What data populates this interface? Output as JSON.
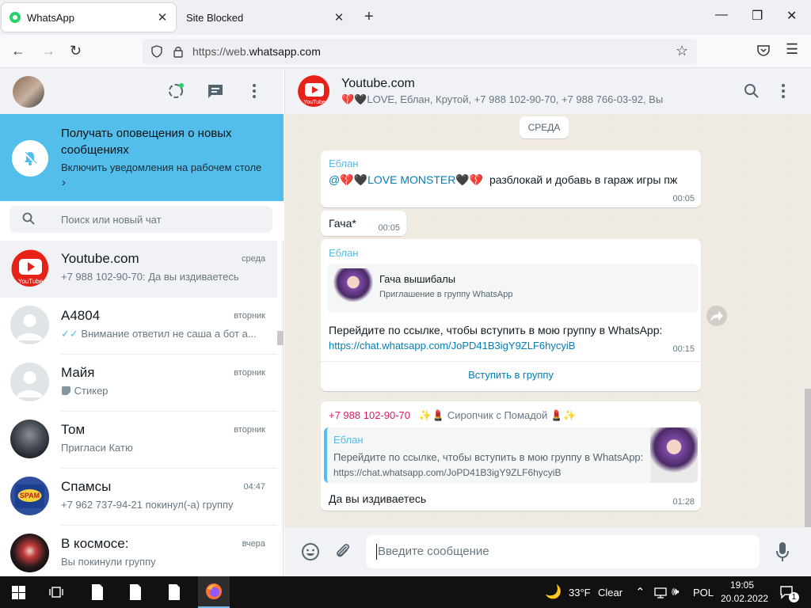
{
  "browser": {
    "tabs": [
      {
        "label": "WhatsApp",
        "active": true
      },
      {
        "label": "Site Blocked",
        "active": false
      }
    ],
    "url": {
      "prefix": "https://web.",
      "domain": "whatsapp.com"
    }
  },
  "sidebar": {
    "notification": {
      "title": "Получать оповещения о новых сообщениях",
      "subtitle": "Включить уведомления на рабочем столе",
      "chevron": "›"
    },
    "search": {
      "placeholder": "Поиск или новый чат"
    },
    "chats": [
      {
        "name": "Youtube.com",
        "time": "среда",
        "last": "+7 988 102-90-70: Да вы издиваетесь",
        "avatar": "youtube"
      },
      {
        "name": "A4804",
        "time": "вторник",
        "last": "Внимание ответил не саша а бот а...",
        "avatar": "default",
        "ticks": "✓✓"
      },
      {
        "name": "Майя",
        "time": "вторник",
        "last": "Стикер",
        "avatar": "default",
        "sticker": true
      },
      {
        "name": "Том",
        "time": "вторник",
        "last": "Пригласи Катю",
        "avatar": "photo-dark"
      },
      {
        "name": "Спамсы",
        "time": "04:47",
        "last": "+7 962 737-94-21 покинул(-а) группу",
        "avatar": "spam"
      },
      {
        "name": "В космосе:",
        "time": "вчера",
        "last": "Вы покинули группу",
        "avatar": "space"
      }
    ]
  },
  "conversation": {
    "title": "Youtube.com",
    "participants": "LOVE, Еблан, Крутой, +7 988 102-90-70, +7 988 766-03-92, Вы",
    "day_label": "СРЕДА",
    "messages": {
      "m1": {
        "sender": "Еблан",
        "mention": "@",
        "mention_name": "LOVE MONSTER",
        "text": "разблокай и добавь в гараж игры пж",
        "time": "00:05"
      },
      "m2": {
        "text": "Гача*",
        "time": "00:05"
      },
      "m3": {
        "sender": "Еблан",
        "invite_title": "Гача вышибалы",
        "invite_sub": "Приглашение в группу WhatsApp",
        "text": "Перейдите по ссылке, чтобы вступить в мою группу в WhatsApp:",
        "link": "https://chat.whatsapp.com/JoPD41B3igY9ZLF6hycyiB",
        "time": "00:15",
        "action": "Вступить в группу"
      },
      "m4": {
        "sender": "+7 988 102-90-70",
        "sender_alias": "Сиропчик с Помадой",
        "quote_sender": "Еблан",
        "quote_text": "Перейдите по ссылке, чтобы вступить в мою группу в WhatsApp:",
        "quote_link": "https://chat.whatsapp.com/JoPD41B3igY9ZLF6hycyiB",
        "text": "Да вы издиваетесь",
        "time": "01:28"
      }
    },
    "composer": {
      "placeholder": "Введите сообщение"
    }
  },
  "taskbar": {
    "weather": "33°F",
    "weather_label": "Clear",
    "lang": "POL",
    "time": "19:05",
    "date": "20.02.2022",
    "notif_count": "1"
  },
  "colors": {
    "notification_bg": "#53bdeb",
    "sender_blue": "#53bdeb",
    "sender_pink": "#d81b60",
    "chat_bg": "#efeae2",
    "link": "#027eb5"
  }
}
